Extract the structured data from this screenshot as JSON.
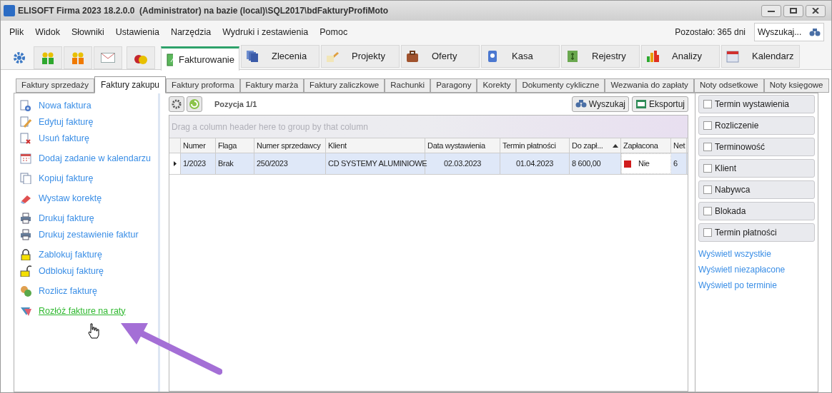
{
  "window": {
    "title": "ELISOFT Firma 2023 18.2.0.0  (Administrator) na bazie (local)\\SQL2017\\bdFakturyProfiMoto"
  },
  "menu": [
    "Plik",
    "Widok",
    "Słowniki",
    "Ustawienia",
    "Narzędzia",
    "Wydruki i zestawienia",
    "Pomoc"
  ],
  "remaining": "Pozostało: 365 dni",
  "search": {
    "placeholder": "Wyszukaj..."
  },
  "module_tabs": [
    {
      "label": "Fakturowanie",
      "selected": true
    },
    {
      "label": "Zlecenia",
      "selected": false
    },
    {
      "label": "Projekty",
      "selected": false
    },
    {
      "label": "Oferty",
      "selected": false
    },
    {
      "label": "Kasa",
      "selected": false
    },
    {
      "label": "Rejestry",
      "selected": false
    },
    {
      "label": "Analizy",
      "selected": false
    },
    {
      "label": "Kalendarz",
      "selected": false
    }
  ],
  "sub_tabs": [
    {
      "label": "Faktury sprzedaży",
      "selected": false
    },
    {
      "label": "Faktury zakupu",
      "selected": true
    },
    {
      "label": "Faktury proforma",
      "selected": false
    },
    {
      "label": "Faktury marża",
      "selected": false
    },
    {
      "label": "Faktury zaliczkowe",
      "selected": false
    },
    {
      "label": "Rachunki",
      "selected": false
    },
    {
      "label": "Paragony",
      "selected": false
    },
    {
      "label": "Korekty",
      "selected": false
    },
    {
      "label": "Dokumenty cykliczne",
      "selected": false
    },
    {
      "label": "Wezwania do zapłaty",
      "selected": false
    },
    {
      "label": "Noty odsetkowe",
      "selected": false
    },
    {
      "label": "Noty księgowe",
      "selected": false
    }
  ],
  "actions": [
    [
      {
        "label": "Nowa faktura",
        "hovered": false
      },
      {
        "label": "Edytuj fakturę",
        "hovered": false
      },
      {
        "label": "Usuń fakturę",
        "hovered": false
      }
    ],
    [
      {
        "label": "Dodaj zadanie w kalendarzu",
        "hovered": false
      }
    ],
    [
      {
        "label": "Kopiuj fakturę",
        "hovered": false
      }
    ],
    [
      {
        "label": "Wystaw korektę",
        "hovered": false
      }
    ],
    [
      {
        "label": "Drukuj fakturę",
        "hovered": false
      },
      {
        "label": "Drukuj zestawienie faktur",
        "hovered": false
      }
    ],
    [
      {
        "label": "Zablokuj fakturę",
        "hovered": false
      },
      {
        "label": "Odblokuj fakturę",
        "hovered": false
      }
    ],
    [
      {
        "label": "Rozlicz fakturę",
        "hovered": false
      }
    ],
    [
      {
        "label": "Rozłóż fakture na raty",
        "hovered": true
      }
    ]
  ],
  "grid": {
    "position": "Pozycja 1/1",
    "buttons": [
      "Wyszukaj",
      "Eksportuj"
    ],
    "group_hint": "Drag a column header here to group by that column",
    "columns": [
      {
        "label": "Numer",
        "sorted": false
      },
      {
        "label": "Flaga",
        "sorted": false
      },
      {
        "label": "Numer sprzedawcy",
        "sorted": false
      },
      {
        "label": "Klient",
        "sorted": false
      },
      {
        "label": "Data wystawienia",
        "sorted": false
      },
      {
        "label": "Termin płatności",
        "sorted": false
      },
      {
        "label": "Do zapł...",
        "sorted": true
      },
      {
        "label": "Zapłacona",
        "sorted": false
      },
      {
        "label": "Net",
        "sorted": false
      }
    ],
    "rows": [
      {
        "selected": true,
        "color": "#d01c1c",
        "cells": [
          "1/2023",
          "Brak",
          "250/2023",
          "CD SYSTEMY ALUMINIOWE",
          "02.03.2023",
          "01.04.2023",
          "8 600,00",
          "Nie",
          "6"
        ]
      }
    ]
  },
  "filters": [
    {
      "label": "Termin wystawienia",
      "checked": false
    },
    {
      "label": "Rozliczenie",
      "checked": false
    },
    {
      "label": "Terminowość",
      "checked": false
    },
    {
      "label": "Klient",
      "checked": false
    },
    {
      "label": "Nabywca",
      "checked": false
    },
    {
      "label": "Blokada",
      "checked": false
    },
    {
      "label": "Termin płatności",
      "checked": false
    }
  ],
  "filter_links": [
    "Wyświetl wszystkie",
    "Wyświetl niezapłacone",
    "Wyświetl po terminie"
  ]
}
